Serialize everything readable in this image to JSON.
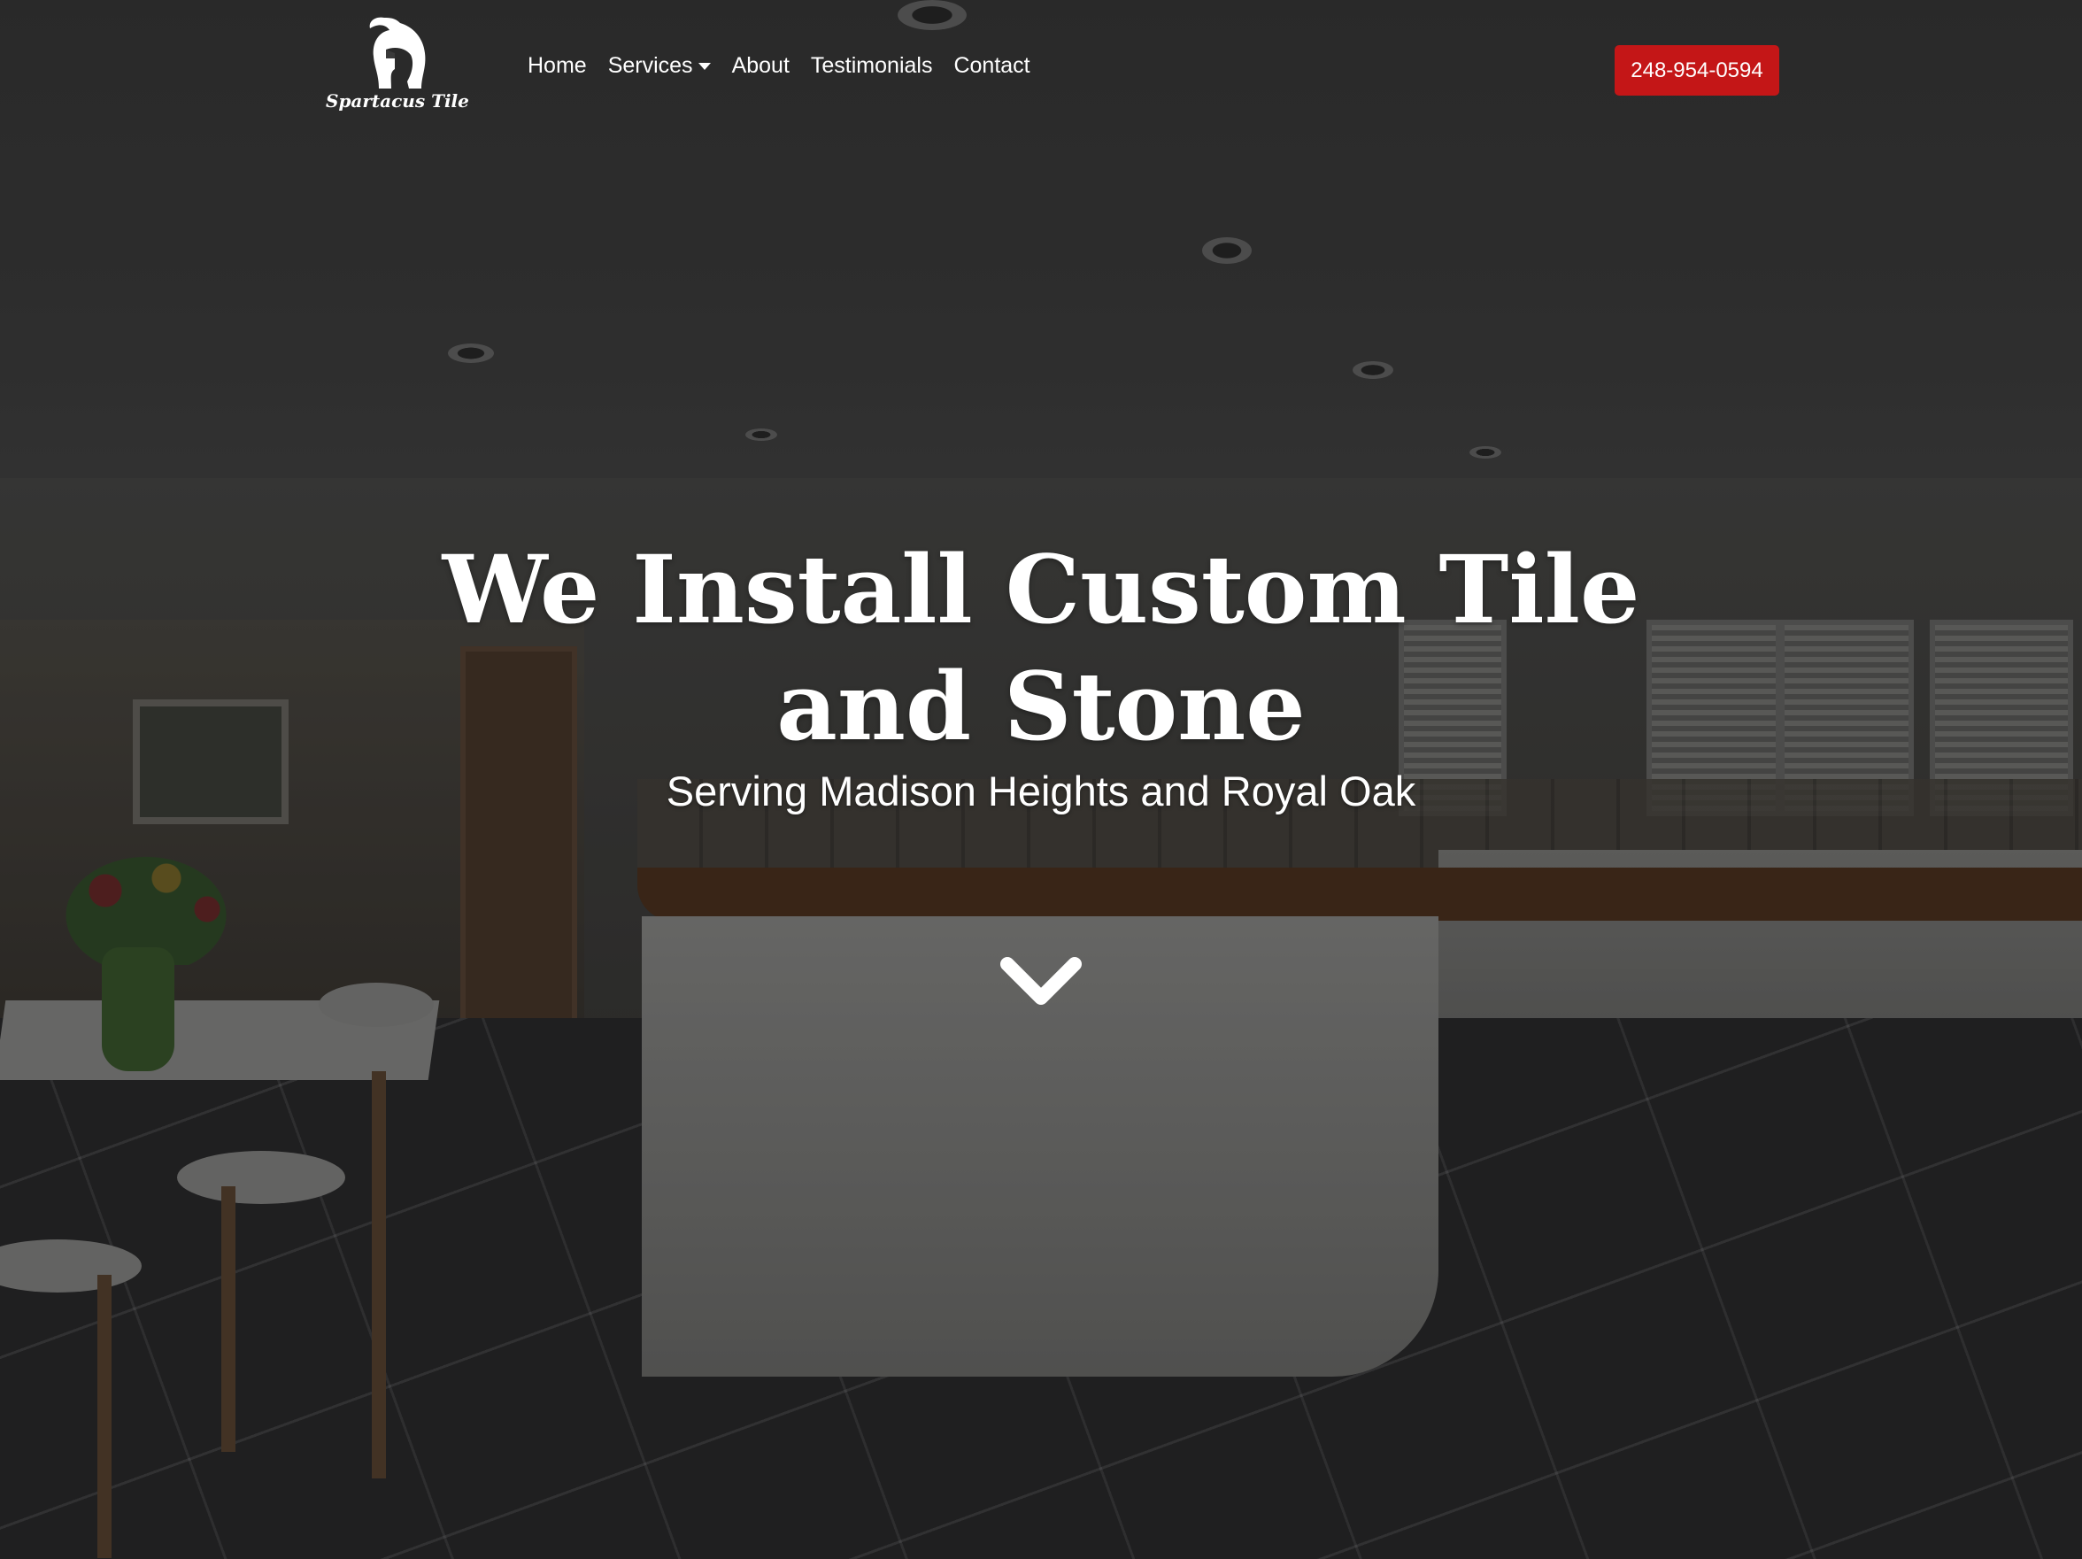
{
  "brand": {
    "name": "Spartacus Tile",
    "logo_icon": "spartan-helmet-icon"
  },
  "nav": {
    "items": [
      {
        "label": "Home"
      },
      {
        "label": "Services",
        "has_dropdown": true
      },
      {
        "label": "About"
      },
      {
        "label": "Testimonials"
      },
      {
        "label": "Contact"
      }
    ],
    "phone_label": "248-954-0594"
  },
  "hero": {
    "title": "We Install Custom Tile and Stone",
    "subtitle": "Serving Madison Heights and Royal Oak",
    "scroll_icon": "chevron-down-icon"
  },
  "colors": {
    "accent": "#c41617",
    "text": "#ffffff"
  }
}
